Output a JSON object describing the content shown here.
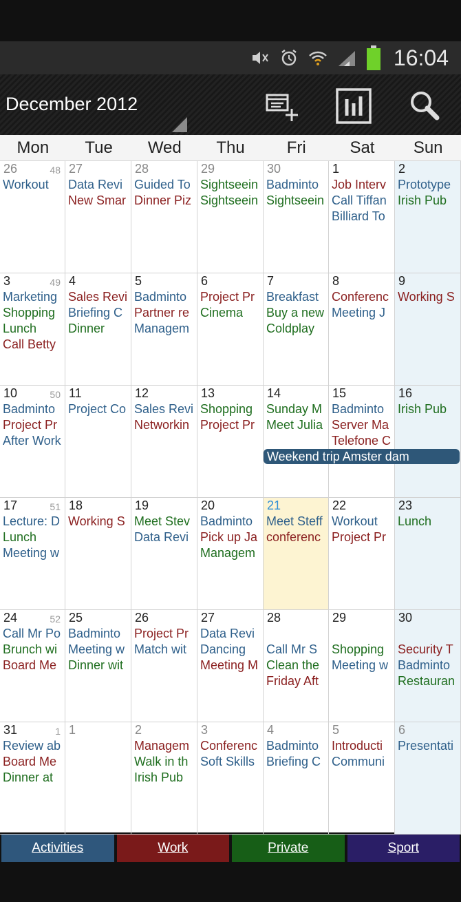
{
  "status": {
    "time": "16:04"
  },
  "header": {
    "title": "December 2012"
  },
  "icons": {
    "add_event": "add-event-icon",
    "view": "agenda-view-icon",
    "search": "search-icon"
  },
  "weekdays": [
    "Mon",
    "Tue",
    "Wed",
    "Thu",
    "Fri",
    "Sat",
    "Sun"
  ],
  "colors": {
    "activities": "#2e5f8a",
    "work": "#8a1f1f",
    "private": "#1f6e1f",
    "sport": "#3b2a7a",
    "today": "#fdf4d2",
    "sunday": "#eaf3f8"
  },
  "weeks": [
    {
      "week": "48",
      "days": [
        {
          "day": "26",
          "dim": true,
          "events": [
            {
              "t": "Workout",
              "c": "activities"
            }
          ]
        },
        {
          "day": "27",
          "dim": true,
          "events": [
            {
              "t": "Data Revi",
              "c": "activities"
            },
            {
              "t": "New Smar",
              "c": "work"
            }
          ]
        },
        {
          "day": "28",
          "dim": true,
          "events": [
            {
              "t": "Guided To",
              "c": "activities"
            },
            {
              "t": "Dinner Piz",
              "c": "work"
            }
          ]
        },
        {
          "day": "29",
          "dim": true,
          "events": [
            {
              "t": "Sightseein",
              "c": "private"
            },
            {
              "t": "Sightseein",
              "c": "private"
            }
          ]
        },
        {
          "day": "30",
          "dim": true,
          "events": [
            {
              "t": "Badminto",
              "c": "activities"
            },
            {
              "t": "Sightseein",
              "c": "private"
            }
          ]
        },
        {
          "day": "1",
          "events": [
            {
              "t": "Job Interv",
              "c": "work"
            },
            {
              "t": "Call Tiffan",
              "c": "activities"
            },
            {
              "t": "Billiard To",
              "c": "activities"
            }
          ]
        },
        {
          "day": "2",
          "events": [
            {
              "t": "Prototype",
              "c": "activities"
            },
            {
              "t": "Irish Pub",
              "c": "private"
            }
          ]
        }
      ]
    },
    {
      "week": "49",
      "days": [
        {
          "day": "3",
          "events": [
            {
              "t": "Marketing",
              "c": "activities"
            },
            {
              "t": "Shopping",
              "c": "private"
            },
            {
              "t": "Lunch",
              "c": "private"
            },
            {
              "t": "Call Betty",
              "c": "work"
            }
          ]
        },
        {
          "day": "4",
          "events": [
            {
              "t": "Sales Revi",
              "c": "work"
            },
            {
              "t": "Briefing C",
              "c": "activities"
            },
            {
              "t": "Dinner",
              "c": "private"
            }
          ]
        },
        {
          "day": "5",
          "events": [
            {
              "t": "Badminto",
              "c": "activities"
            },
            {
              "t": "Partner re",
              "c": "work"
            },
            {
              "t": "Managem",
              "c": "activities"
            }
          ]
        },
        {
          "day": "6",
          "events": [
            {
              "t": "Project Pr",
              "c": "work"
            },
            {
              "t": "Cinema",
              "c": "private"
            }
          ]
        },
        {
          "day": "7",
          "events": [
            {
              "t": "Breakfast",
              "c": "activities"
            },
            {
              "t": "Buy a new",
              "c": "private"
            },
            {
              "t": "Coldplay",
              "c": "private"
            }
          ]
        },
        {
          "day": "8",
          "events": [
            {
              "t": "Conferenc",
              "c": "work"
            },
            {
              "t": "Meeting J",
              "c": "activities"
            }
          ]
        },
        {
          "day": "9",
          "events": [
            {
              "t": "Working S",
              "c": "work"
            }
          ]
        }
      ]
    },
    {
      "week": "50",
      "days": [
        {
          "day": "10",
          "events": [
            {
              "t": "Badminto",
              "c": "activities"
            },
            {
              "t": "Project Pr",
              "c": "work"
            },
            {
              "t": "After Work",
              "c": "activities"
            }
          ]
        },
        {
          "day": "11",
          "events": [
            {
              "t": "Project Co",
              "c": "activities"
            }
          ]
        },
        {
          "day": "12",
          "events": [
            {
              "t": "Sales Revi",
              "c": "activities"
            },
            {
              "t": "Networkin",
              "c": "work"
            }
          ]
        },
        {
          "day": "13",
          "events": [
            {
              "t": "Shopping",
              "c": "private"
            },
            {
              "t": "Project Pr",
              "c": "work"
            }
          ]
        },
        {
          "day": "14",
          "events": [
            {
              "t": "Sunday M",
              "c": "private"
            },
            {
              "t": "Meet Julia",
              "c": "private"
            }
          ]
        },
        {
          "day": "15",
          "events": [
            {
              "t": "Badminto",
              "c": "activities"
            },
            {
              "t": "Server Ma",
              "c": "work"
            },
            {
              "t": "Telefone C",
              "c": "work"
            }
          ]
        },
        {
          "day": "16",
          "events": [
            {
              "t": "Irish Pub",
              "c": "private"
            }
          ]
        }
      ]
    },
    {
      "week": "51",
      "days": [
        {
          "day": "17",
          "events": [
            {
              "t": "Lecture: D",
              "c": "activities"
            },
            {
              "t": "Lunch",
              "c": "private"
            },
            {
              "t": "Meeting w",
              "c": "activities"
            }
          ]
        },
        {
          "day": "18",
          "events": [
            {
              "t": "Working S",
              "c": "work"
            }
          ]
        },
        {
          "day": "19",
          "events": [
            {
              "t": "Meet Stev",
              "c": "private"
            },
            {
              "t": "Data Revi",
              "c": "activities"
            }
          ]
        },
        {
          "day": "20",
          "events": [
            {
              "t": "Badminto",
              "c": "activities"
            },
            {
              "t": "Pick up Ja",
              "c": "work"
            },
            {
              "t": "Managem",
              "c": "private"
            }
          ]
        },
        {
          "day": "21",
          "today": true,
          "events": [
            {
              "t": "Meet Steff",
              "c": "activities"
            },
            {
              "t": "conferenc",
              "c": "work"
            }
          ]
        },
        {
          "day": "22",
          "events": [
            {
              "t": "Workout",
              "c": "activities"
            },
            {
              "t": "Project Pr",
              "c": "work"
            }
          ]
        },
        {
          "day": "23",
          "events": [
            {
              "t": "Lunch",
              "c": "private"
            }
          ]
        }
      ]
    },
    {
      "week": "52",
      "days": [
        {
          "day": "24",
          "events": [
            {
              "t": "Call Mr Po",
              "c": "activities"
            },
            {
              "t": "Brunch wi",
              "c": "private"
            },
            {
              "t": "Board Me",
              "c": "work"
            }
          ]
        },
        {
          "day": "25",
          "events": [
            {
              "t": "Badminto",
              "c": "activities"
            },
            {
              "t": "Meeting w",
              "c": "activities"
            },
            {
              "t": "Dinner wit",
              "c": "private"
            }
          ]
        },
        {
          "day": "26",
          "events": [
            {
              "t": "Project Pr",
              "c": "work"
            },
            {
              "t": "Match wit",
              "c": "activities"
            }
          ]
        },
        {
          "day": "27",
          "events": [
            {
              "t": "Data Revi",
              "c": "activities"
            },
            {
              "t": "Dancing",
              "c": "activities"
            },
            {
              "t": "Meeting M",
              "c": "work"
            }
          ]
        },
        {
          "day": "28",
          "span": true,
          "events": [
            {
              "t": "Call Mr S",
              "c": "activities"
            },
            {
              "t": "Clean the",
              "c": "private"
            },
            {
              "t": "Friday Aft",
              "c": "work"
            }
          ]
        },
        {
          "day": "29",
          "span": true,
          "events": [
            {
              "t": "Shopping",
              "c": "private"
            },
            {
              "t": "Meeting w",
              "c": "activities"
            }
          ]
        },
        {
          "day": "30",
          "span": true,
          "events": [
            {
              "t": "Security T",
              "c": "work"
            },
            {
              "t": "Badminto",
              "c": "activities"
            },
            {
              "t": "Restauran",
              "c": "private"
            }
          ]
        }
      ]
    },
    {
      "week": "1",
      "days": [
        {
          "day": "31",
          "events": [
            {
              "t": "Review ab",
              "c": "activities"
            },
            {
              "t": "Board Me",
              "c": "work"
            },
            {
              "t": "Dinner at",
              "c": "private"
            }
          ]
        },
        {
          "day": "1",
          "dim": true,
          "events": []
        },
        {
          "day": "2",
          "dim": true,
          "events": [
            {
              "t": "Managem",
              "c": "work"
            },
            {
              "t": "Walk in th",
              "c": "private"
            },
            {
              "t": "Irish Pub",
              "c": "private"
            }
          ]
        },
        {
          "day": "3",
          "dim": true,
          "events": [
            {
              "t": "Conferenc",
              "c": "work"
            },
            {
              "t": "Soft Skills",
              "c": "activities"
            }
          ]
        },
        {
          "day": "4",
          "dim": true,
          "events": [
            {
              "t": "Badminto",
              "c": "activities"
            },
            {
              "t": "Briefing C",
              "c": "activities"
            }
          ]
        },
        {
          "day": "5",
          "dim": true,
          "events": [
            {
              "t": "Introducti",
              "c": "work"
            },
            {
              "t": "Communi",
              "c": "activities"
            }
          ]
        },
        {
          "day": "6",
          "dim": true,
          "events": [
            {
              "t": "Presentati",
              "c": "activities"
            }
          ]
        }
      ]
    }
  ],
  "spanning_event": {
    "title": "Weekend trip Amster dam"
  },
  "categories": [
    {
      "label": "Activities",
      "color": "#2f577c"
    },
    {
      "label": "Work",
      "color": "#7a1a1a"
    },
    {
      "label": "Private",
      "color": "#175e17"
    },
    {
      "label": "Sport",
      "color": "#2a1e66"
    }
  ]
}
